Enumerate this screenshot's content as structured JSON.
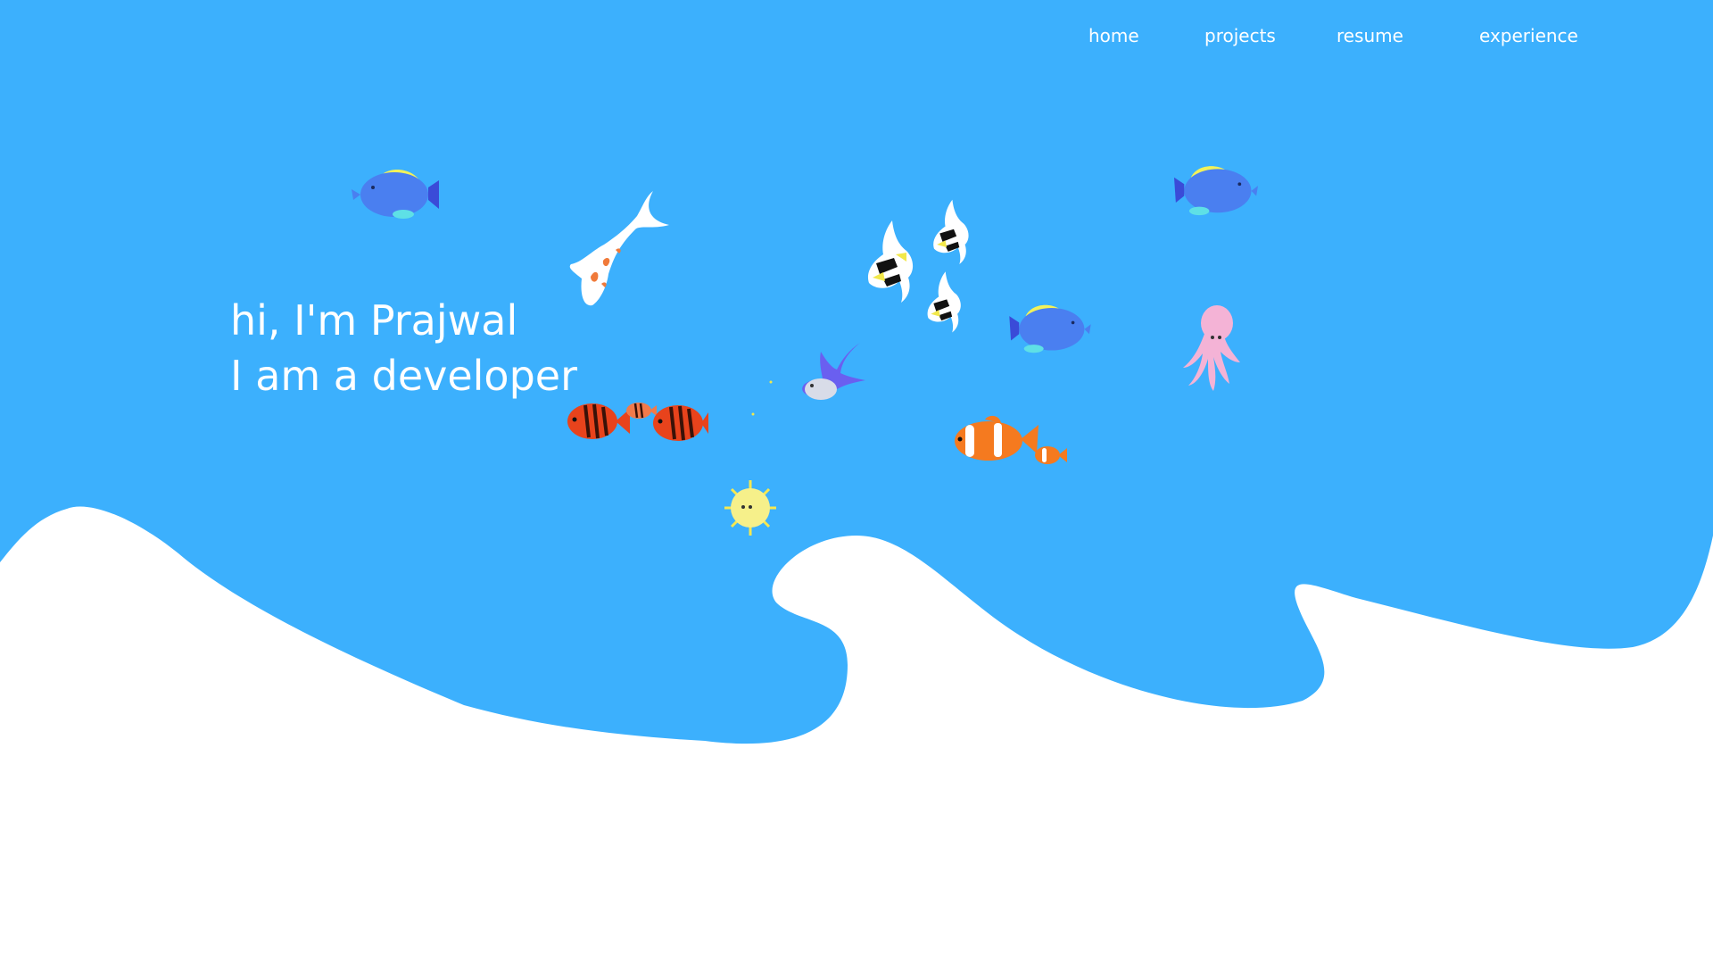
{
  "nav": {
    "items": [
      {
        "label": "home"
      },
      {
        "label": "projects"
      },
      {
        "label": "resume"
      },
      {
        "label": "experience"
      }
    ]
  },
  "hero": {
    "greeting": "hi, I'm Prajwal",
    "tagline": "I am a developer"
  },
  "colors": {
    "ocean": "#3CB0FD",
    "page": "#FFFFFF",
    "text": "#FFFFFF",
    "tang_body": "#4A7FF0",
    "tang_fin": "#F2F25A",
    "clownfish": "#F57A1F",
    "tiger_fish": "#E8431C",
    "octopus": "#F4B3D6",
    "pufferfish": "#F6F08A"
  },
  "decorations": [
    {
      "name": "blue-tang-fish-icon"
    },
    {
      "name": "koi-fish-icon"
    },
    {
      "name": "moorish-idol-fish-icon"
    },
    {
      "name": "blue-tang-fish-icon"
    },
    {
      "name": "octopus-icon"
    },
    {
      "name": "tiger-fish-icon"
    },
    {
      "name": "pufferfish-icon"
    },
    {
      "name": "clownfish-icon"
    },
    {
      "name": "violet-fish-icon"
    }
  ]
}
